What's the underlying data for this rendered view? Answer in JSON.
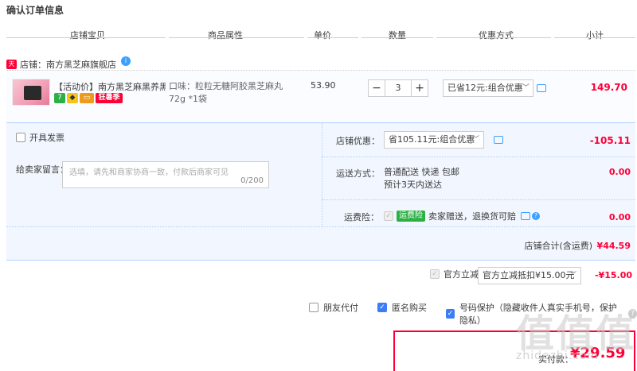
{
  "page_title": "确认订单信息",
  "columns": [
    "店铺宝贝",
    "商品属性",
    "单价",
    "数量",
    "优惠方式",
    "小计"
  ],
  "shop": {
    "badge": "天猫",
    "label": "店铺：南方黑芝麻旗舰店",
    "ww": "i"
  },
  "item": {
    "name": "【活动价】南方黑芝麻黑养黑7...",
    "tags": [
      "7",
      "◆",
      "▭",
      "狂暑季"
    ],
    "attr": "口味：粒粒无糖阿胶黑芝麻丸72g *1袋",
    "price": "53.90",
    "qty_minus": "−",
    "qty": "3",
    "qty_plus": "+",
    "promo": "已省12元:组合优惠",
    "subtotal": "149.70"
  },
  "invoice_label": "开具发票",
  "note": {
    "label": "给卖家留言：",
    "placeholder": "选填，请先和商家协商一致，付款后商家可见",
    "count": "0/200"
  },
  "shop_discount": {
    "label": "店铺优惠：",
    "select": "省105.11元:组合优惠",
    "value": "-105.11"
  },
  "shipping": {
    "label": "运送方式：",
    "line1": "普通配送 快递 包邮",
    "line2": "预计3天内送达",
    "value": "0.00"
  },
  "insurance": {
    "label": "运费险：",
    "badge": "运费险",
    "text": "卖家赠送，退换货可赔",
    "value": "0.00"
  },
  "shop_total": {
    "label": "店铺合计(含运费)",
    "value": "¥44.59"
  },
  "official": {
    "label": "官方立减",
    "select": "官方立减抵扣¥15.00元",
    "value": "-¥15.00"
  },
  "options": {
    "friend_pay": "朋友代付",
    "anonymous": "匿名购买",
    "privacy": "号码保护（隐藏收件人真实手机号，保护隐私）"
  },
  "pay": {
    "label": "实付款：",
    "amount": "¥29.59"
  },
  "watermark": {
    "big": "值值值",
    "small": "zhidezhi.com"
  }
}
